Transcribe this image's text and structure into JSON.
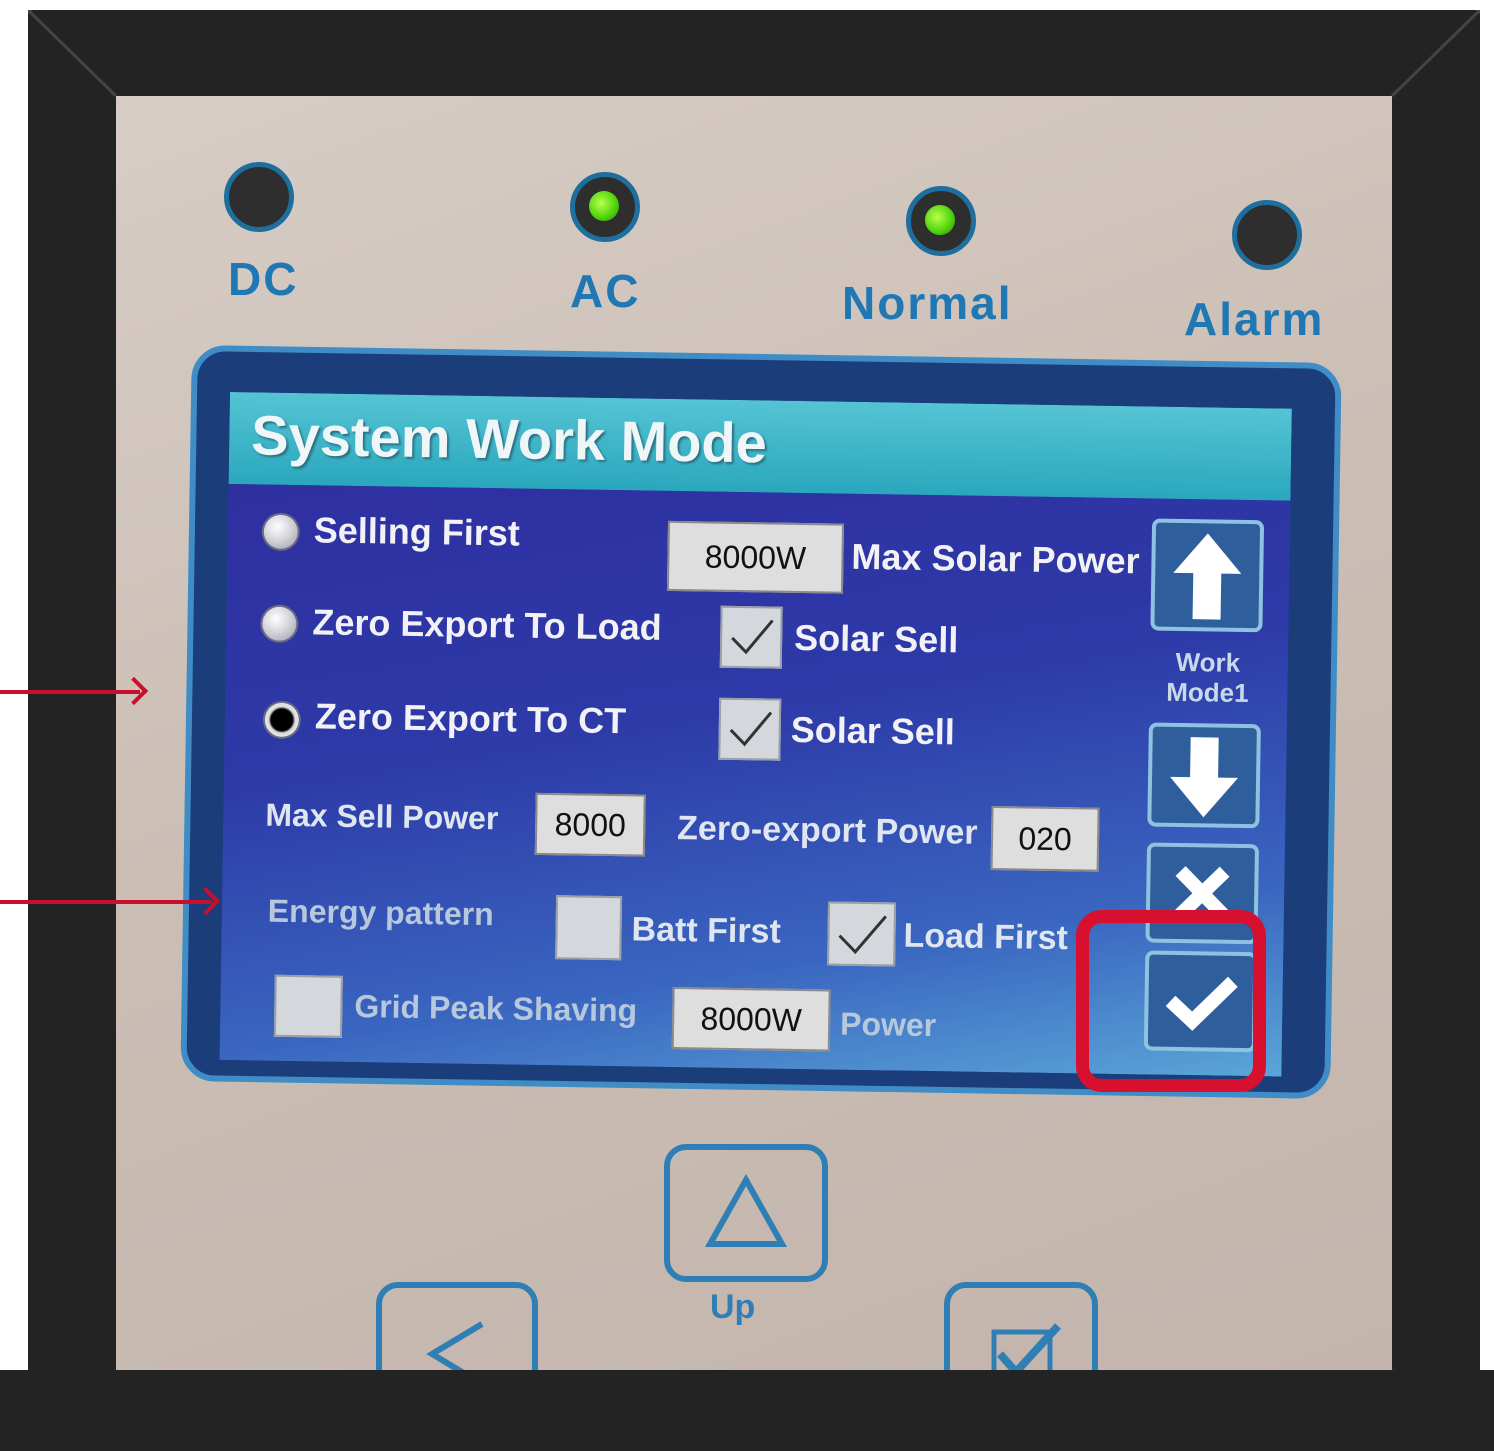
{
  "indicators": [
    {
      "label": "DC",
      "lit": false
    },
    {
      "label": "AC",
      "lit": true
    },
    {
      "label": "Normal",
      "lit": true
    },
    {
      "label": "Alarm",
      "lit": false
    }
  ],
  "screen": {
    "title": "System Work Mode",
    "modes": [
      {
        "label": "Selling First",
        "selected": false
      },
      {
        "label": "Zero Export To Load",
        "selected": false
      },
      {
        "label": "Zero Export To CT",
        "selected": true
      }
    ],
    "max_solar_power": {
      "value": "8000W",
      "label": "Max Solar Power"
    },
    "solar_sell_load": {
      "label": "Solar Sell",
      "checked": true
    },
    "solar_sell_ct": {
      "label": "Solar Sell",
      "checked": true
    },
    "max_sell_power": {
      "label": "Max Sell Power",
      "value": "8000"
    },
    "zero_export_power": {
      "label": "Zero-export Power",
      "value": "020"
    },
    "energy_pattern": {
      "label": "Energy pattern",
      "batt_first": {
        "label": "Batt First",
        "checked": false
      },
      "load_first": {
        "label": "Load First",
        "checked": true
      }
    },
    "grid_peak_shaving": {
      "label": "Grid Peak Shaving",
      "checked": false,
      "value": "8000W",
      "unit_label": "Power"
    },
    "side_panel": {
      "work_mode_line1": "Work",
      "work_mode_line2": "Mode1"
    }
  },
  "hardware_buttons": {
    "up_label": "Up"
  },
  "colors": {
    "accent_highlight": "#d8102f",
    "led_green": "#52d70f",
    "screen_blue": "#2a3fa6",
    "title_teal": "#2aa7bd"
  }
}
